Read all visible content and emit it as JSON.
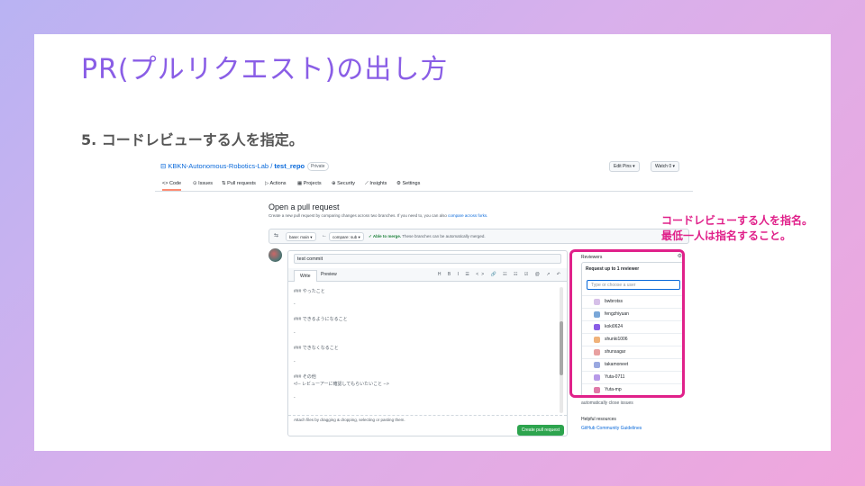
{
  "slide": {
    "title": "PR(プルリクエスト)の出し方",
    "step": "5. コードレビューする人を指定。",
    "note_line1": "コードレビューする人を指名。",
    "note_line2": "最低一人は指名すること。"
  },
  "repo": {
    "owner": "KBKN-Autonomous-Robotics-Lab",
    "sep": " / ",
    "name": "test_repo",
    "visibility": "Private",
    "edit_pins": "Edit Pins ▾",
    "watch": "Watch 0 ▾"
  },
  "tabs": [
    "Code",
    "Issues",
    "Pull requests",
    "Actions",
    "Projects",
    "Security",
    "Insights",
    "Settings"
  ],
  "page": {
    "heading": "Open a pull request",
    "description": "Create a new pull request by comparing changes across two branches. If you need to, you can also",
    "description_link": "compare across forks.",
    "base": "base: main ▾",
    "arrow": "←",
    "compare": "compare: sub ▾",
    "able": "✓ Able to merge.",
    "able_rest": "These branches can be automatically merged."
  },
  "compose": {
    "title_value": "test commit",
    "tab_write": "Write",
    "tab_preview": "Preview",
    "tools": "H B I ☰ <> 🔗 ☷ ☷ ☑ @ ↗ ↶",
    "lines": [
      "### やったこと",
      "-",
      "### できるようになること",
      "-",
      "### できなくなること",
      "-",
      "### その他",
      "<!-- レビューアーに確認してもらいたいこと -->",
      "-"
    ],
    "attach": "Attach files by dragging & dropping, selecting or pasting them.",
    "create_button": "Create pull request"
  },
  "sidebar": {
    "reviewers_label": "Reviewers",
    "panel_header": "Request up to 1 reviewer",
    "filter_placeholder": "Type or choose a user",
    "reviewers": [
      "bwbrotss",
      "fengzhiyuan",
      "koki0624",
      "shunki1006",
      "shunsagar",
      "takamoneet",
      "Yuta-0711",
      "Yuta-mp"
    ],
    "auto_close": "automatically close issues",
    "helpful": "Helpful resources",
    "guidelines": "GitHub Community Guidelines"
  },
  "colors": {
    "accent_title": "#8a5ee6",
    "highlight": "#e0218a",
    "link": "#0969da",
    "create_button": "#2da44e"
  }
}
